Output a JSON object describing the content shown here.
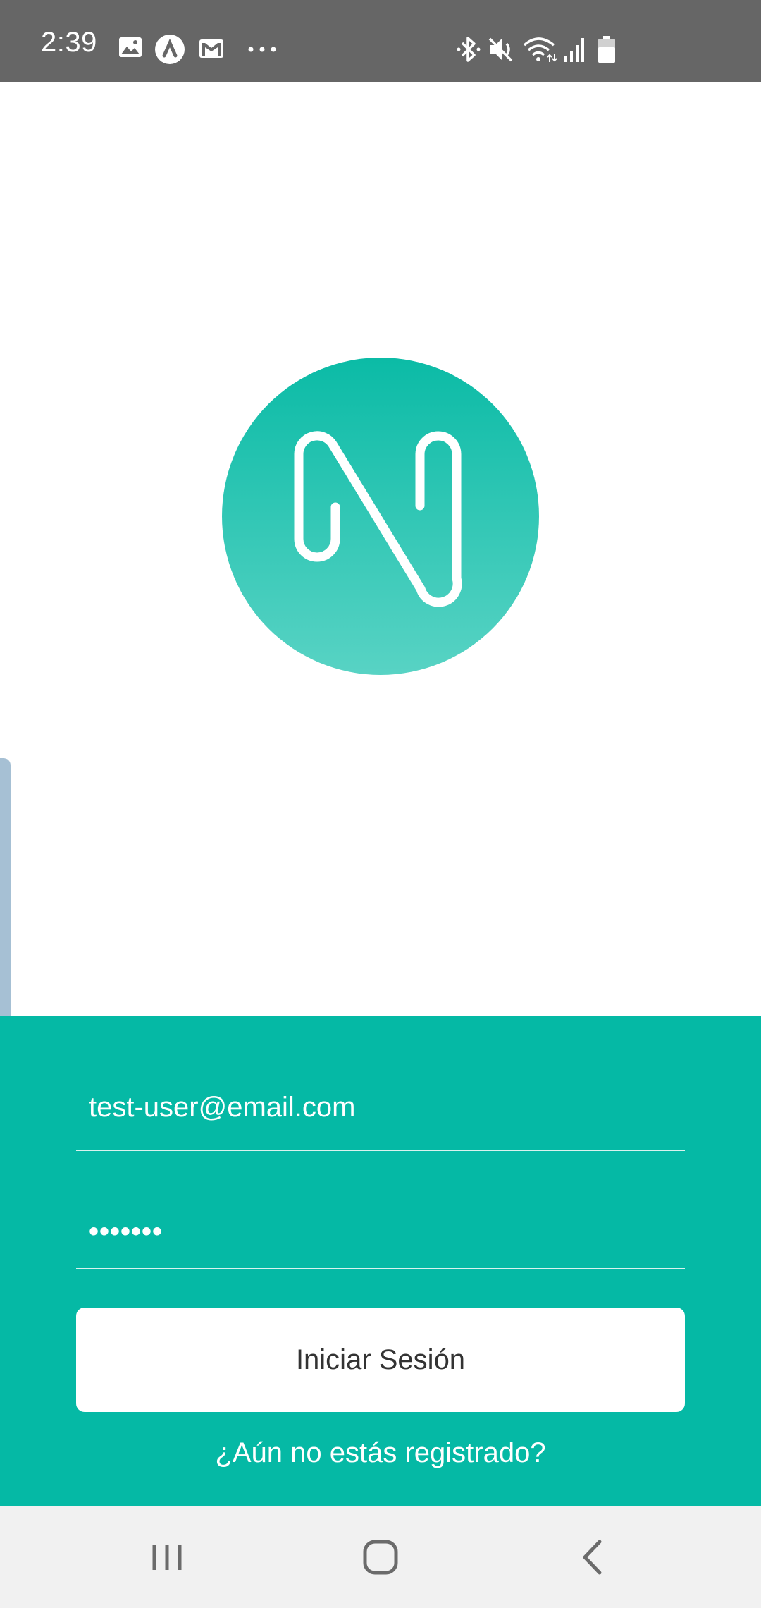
{
  "status_bar": {
    "time": "2:39",
    "left_icons": [
      "image-icon",
      "a-circle-icon",
      "gmail-icon",
      "more-dots-icon"
    ],
    "right_icons": [
      "bluetooth-icon",
      "mute-icon",
      "wifi-icon",
      "signal-icon",
      "battery-icon"
    ],
    "background": "#666666"
  },
  "logo": {
    "icon": "n-logo-icon",
    "color_top": "#0bbba6",
    "color_bottom": "#58d3c4"
  },
  "login": {
    "background": "#05b9a5",
    "email_value": "test-user@email.com",
    "password_value": "•••••••",
    "submit_label": "Iniciar Sesión",
    "register_link": "¿Aún no estás registrado?"
  },
  "nav_bar": {
    "items": [
      "recent-apps-icon",
      "home-icon",
      "back-icon"
    ],
    "background": "#f1f1f1"
  }
}
